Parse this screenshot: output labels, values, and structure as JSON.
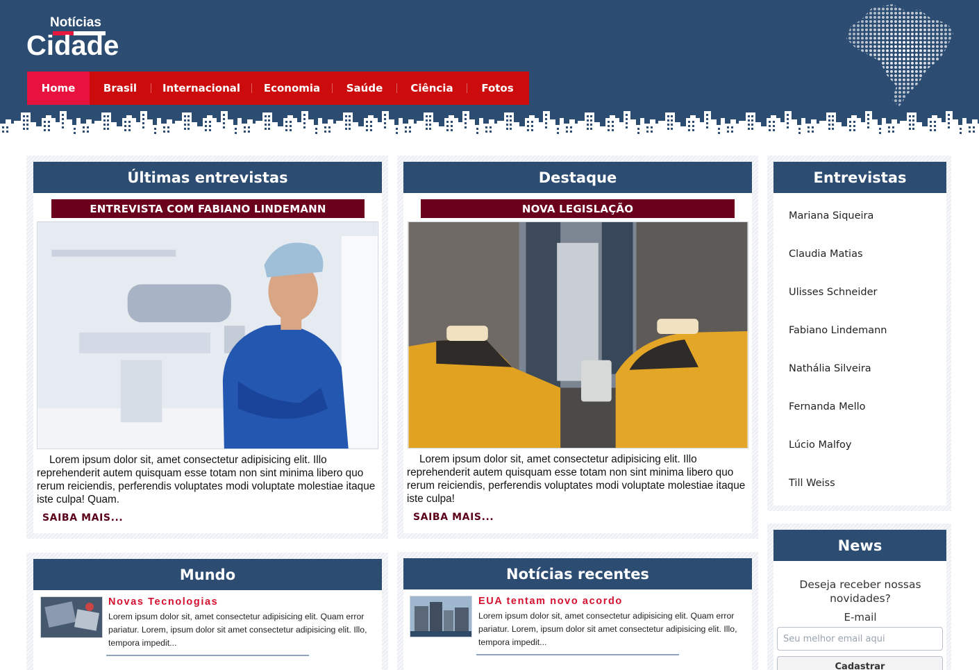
{
  "header": {
    "logo_small": "Notícias",
    "logo_big": "Cidade",
    "nav": [
      "Home",
      "Brasil",
      "Internacional",
      "Economia",
      "Saúde",
      "Ciência",
      "Fotos"
    ],
    "active_nav": "Home"
  },
  "colors": {
    "header_bg": "#2c4c72",
    "nav_bg": "#cc0c0c",
    "nav_active": "#e8123e",
    "subtitle_bg": "#6b001c",
    "news_title": "#d5102f"
  },
  "interviews": {
    "title": "Últimas entrevistas",
    "subtitle": "ENTREVISTA COM FABIANO LINDEMANN",
    "text": "Lorem ipsum dolor sit, amet consectetur adipisicing elit. Illo reprehenderit autem quisquam esse totam non sint minima libero quo rerum reiciendis, perferendis voluptates modi voluptate molestiae itaque iste culpa! Quam.",
    "read_more": "SAIBA MAIS..."
  },
  "featured": {
    "title": "Destaque",
    "subtitle": "NOVA LEGISLAÇÃO",
    "text": "Lorem ipsum dolor sit, amet consectetur adipisicing elit. Illo reprehenderit autem quisquam esse totam non sint minima libero quo rerum reiciendis, perferendis voluptates modi voluptate molestiae itaque iste culpa!",
    "read_more": "SAIBA MAIS..."
  },
  "sidebar": {
    "title": "Entrevistas",
    "items": [
      "Mariana Siqueira",
      "Claudia Matias",
      "Ulisses Schneider",
      "Fabiano Lindemann",
      "Nathália Silveira",
      "Fernanda Mello",
      "Lúcio Malfoy",
      "Till Weiss"
    ]
  },
  "world": {
    "title": "Mundo",
    "item_title": "Novas Tecnologias",
    "item_text": "Lorem ipsum dolor sit, amet consectetur adipisicing elit. Quam error pariatur. Lorem, ipsum dolor sit amet consectetur adipisicing elit. Illo, tempora impedit..."
  },
  "recent": {
    "title": "Notícias recentes",
    "item_title": "EUA tentam novo acordo",
    "item_text": "Lorem ipsum dolor sit, amet consectetur adipisicing elit. Quam error pariatur. Lorem, ipsum dolor sit amet consectetur adipisicing elit. Illo, tempora impedit..."
  },
  "newsletter": {
    "title": "News",
    "prompt": "Deseja receber nossas novidades?",
    "label": "E-mail",
    "placeholder": "Seu melhor email aqui",
    "button": "Cadastrar"
  }
}
